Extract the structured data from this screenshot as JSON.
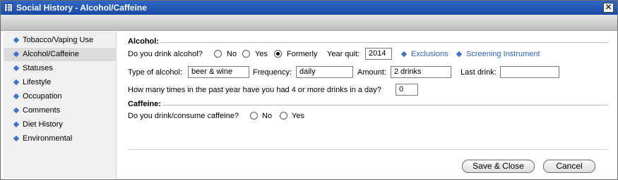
{
  "window": {
    "title": "Social History - Alcohol/Caffeine",
    "close_glyph": "✕"
  },
  "sidebar": {
    "items": [
      {
        "label": "Tobacco/Vaping Use"
      },
      {
        "label": "Alcohol/Caffeine"
      },
      {
        "label": "Statuses"
      },
      {
        "label": "Lifestyle"
      },
      {
        "label": "Occupation"
      },
      {
        "label": "Comments"
      },
      {
        "label": "Diet History"
      },
      {
        "label": "Environmental"
      }
    ]
  },
  "alcohol": {
    "section_title": "Alcohol:",
    "question": "Do you drink alcohol?",
    "options": [
      "No",
      "Yes",
      "Formerly"
    ],
    "selected_option": "Formerly",
    "year_quit_label": "Year quit:",
    "year_quit_value": "2014",
    "exclusions_link": "Exclusions",
    "screening_link": "Screening Instrument",
    "type_label": "Type of alcohol:",
    "type_value": "beer & wine",
    "frequency_label": "Frequency:",
    "frequency_value": "daily",
    "amount_label": "Amount:",
    "amount_value": "2 drinks",
    "last_drink_label": "Last drink:",
    "last_drink_value": "",
    "binge_question": "How many times in the past year have you had 4 or more drinks in a day?",
    "binge_value": "0"
  },
  "caffeine": {
    "section_title": "Caffeine:",
    "question": "Do you drink/consume caffeine?",
    "options": [
      "No",
      "Yes"
    ],
    "selected_option": ""
  },
  "footer": {
    "save_label": "Save & Close",
    "cancel_label": "Cancel"
  }
}
